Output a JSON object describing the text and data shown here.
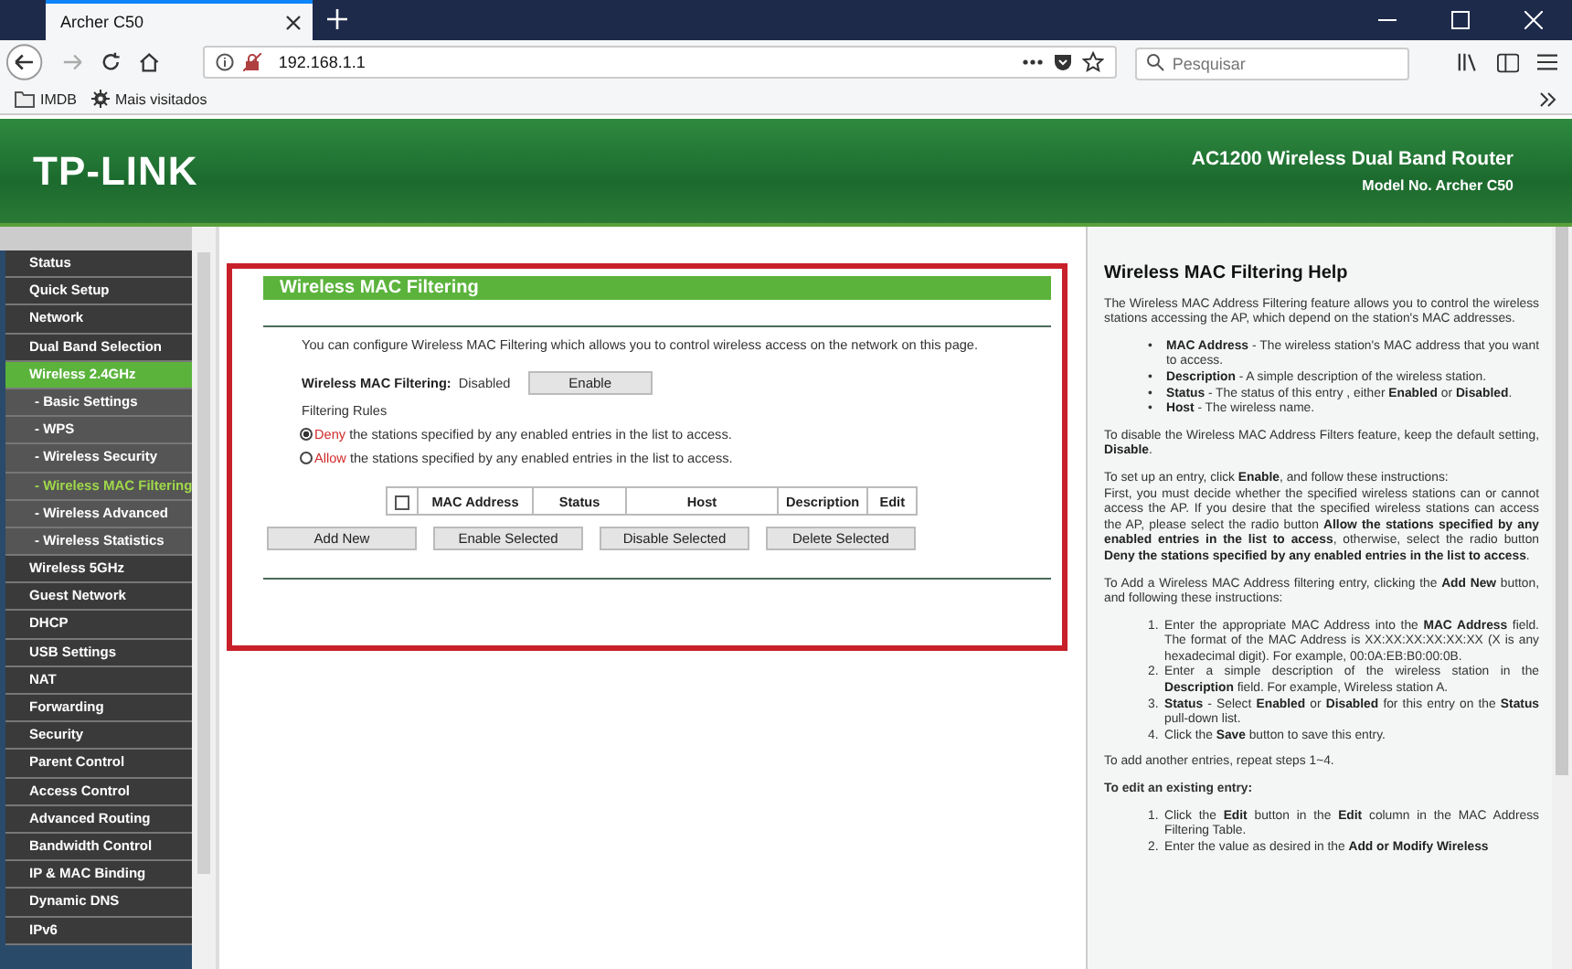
{
  "browser": {
    "tab_title": "Archer C50",
    "url": "192.168.1.1",
    "search_placeholder": "Pesquisar",
    "bookmarks": [
      "IMDB",
      "Mais visitados"
    ]
  },
  "header": {
    "logo": "TP-LINK",
    "product": "AC1200 Wireless Dual Band Router",
    "model": "Model No. Archer C50"
  },
  "sidebar": {
    "items": [
      {
        "label": "Status",
        "kind": "main",
        "selected": false
      },
      {
        "label": "Quick Setup",
        "kind": "main",
        "selected": false
      },
      {
        "label": "Network",
        "kind": "main",
        "selected": false
      },
      {
        "label": "Dual Band Selection",
        "kind": "main",
        "selected": false
      },
      {
        "label": "Wireless 2.4GHz",
        "kind": "main",
        "selected": true
      },
      {
        "label": "- Basic Settings",
        "kind": "sub",
        "selected": false
      },
      {
        "label": "- WPS",
        "kind": "sub",
        "selected": false
      },
      {
        "label": "- Wireless Security",
        "kind": "sub",
        "selected": false
      },
      {
        "label": "- Wireless MAC Filtering",
        "kind": "sub",
        "selected": true
      },
      {
        "label": "- Wireless Advanced",
        "kind": "sub",
        "selected": false
      },
      {
        "label": "- Wireless Statistics",
        "kind": "sub",
        "selected": false
      },
      {
        "label": "Wireless 5GHz",
        "kind": "main",
        "selected": false
      },
      {
        "label": "Guest Network",
        "kind": "main",
        "selected": false
      },
      {
        "label": "DHCP",
        "kind": "main",
        "selected": false
      },
      {
        "label": "USB Settings",
        "kind": "main",
        "selected": false
      },
      {
        "label": "NAT",
        "kind": "main",
        "selected": false
      },
      {
        "label": "Forwarding",
        "kind": "main",
        "selected": false
      },
      {
        "label": "Security",
        "kind": "main",
        "selected": false
      },
      {
        "label": "Parent Control",
        "kind": "main",
        "selected": false
      },
      {
        "label": "Access Control",
        "kind": "main",
        "selected": false
      },
      {
        "label": "Advanced Routing",
        "kind": "main",
        "selected": false
      },
      {
        "label": "Bandwidth Control",
        "kind": "main",
        "selected": false
      },
      {
        "label": "IP & MAC Binding",
        "kind": "main",
        "selected": false
      },
      {
        "label": "Dynamic DNS",
        "kind": "main",
        "selected": false
      },
      {
        "label": "IPv6",
        "kind": "main",
        "selected": false
      }
    ]
  },
  "main": {
    "title": "Wireless MAC Filtering",
    "intro": "You can configure Wireless MAC Filtering which allows you to control wireless access on the network on this page.",
    "status_label": "Wireless MAC Filtering:",
    "status_value": "Disabled",
    "enable_button": "Enable",
    "rules_label": "Filtering Rules",
    "rules": [
      {
        "keyword": "Deny",
        "text": " the stations specified by any enabled entries in the list to access.",
        "selected": true
      },
      {
        "keyword": "Allow",
        "text": " the stations specified by any enabled entries in the list to access.",
        "selected": false
      }
    ],
    "table": {
      "select_all_checked": false,
      "columns": [
        "MAC Address",
        "Status",
        "Host",
        "Description",
        "Edit"
      ]
    },
    "buttons": [
      "Add New",
      "Enable Selected",
      "Disable Selected",
      "Delete Selected"
    ]
  },
  "help": {
    "title": "Wireless MAC Filtering Help",
    "blocks": [
      {
        "kind": "p",
        "text": "The Wireless MAC Address Filtering feature allows you to control the wireless stations accessing the AP, which depend on the station's MAC addresses."
      },
      {
        "kind": "ul",
        "items": [
          {
            "marker": "•",
            "text": "**MAC Address** - The wireless station's MAC address that you want to access."
          },
          {
            "marker": "•",
            "text": "**Description** - A simple description of the wireless station."
          },
          {
            "marker": "•",
            "text": "**Status** - The status of this entry , either **Enabled** or **Disabled**."
          },
          {
            "marker": "•",
            "text": "**Host** - The wireless name."
          }
        ]
      },
      {
        "kind": "p",
        "text": "To disable the Wireless MAC Address Filters feature, keep the default setting, **Disable**."
      },
      {
        "kind": "p",
        "text": "To set up an entry, click **Enable**, and follow these instructions:"
      },
      {
        "kind": "pc",
        "text": "First, you must decide whether the specified wireless stations can or cannot access the AP. If you desire that the specified wireless stations can access the AP, please select the radio button **Allow the stations specified by any enabled entries in the list to access**, otherwise, select the radio button **Deny the stations specified by any enabled entries in the list to access**."
      },
      {
        "kind": "p",
        "text": "To Add a Wireless MAC Address filtering entry, clicking the **Add New** button, and following these instructions:"
      },
      {
        "kind": "ol",
        "items": [
          {
            "marker": "1.",
            "text": "Enter the appropriate MAC Address into the **MAC Address** field. The format of the MAC Address is XX:XX:XX:XX:XX:XX (X is any hexadecimal digit). For example, 00:0A:EB:B0:00:0B."
          },
          {
            "marker": "2.",
            "text": "Enter a simple description of the wireless station in the **Description** field. For example, Wireless station A."
          },
          {
            "marker": "3.",
            "text": "**Status** - Select **Enabled** or **Disabled** for this entry on the **Status** pull-down list."
          },
          {
            "marker": "4.",
            "text": "Click the **Save** button to save this entry."
          }
        ]
      },
      {
        "kind": "p",
        "text": "To add another entries, repeat steps 1~4."
      },
      {
        "kind": "h",
        "text": "To edit an existing entry:"
      },
      {
        "kind": "ol",
        "items": [
          {
            "marker": "1.",
            "text": "Click the **Edit** button in the **Edit** column in the MAC Address Filtering Table."
          },
          {
            "marker": "2.",
            "text": "Enter the value as desired in the **Add or Modify Wireless**"
          }
        ]
      }
    ]
  }
}
